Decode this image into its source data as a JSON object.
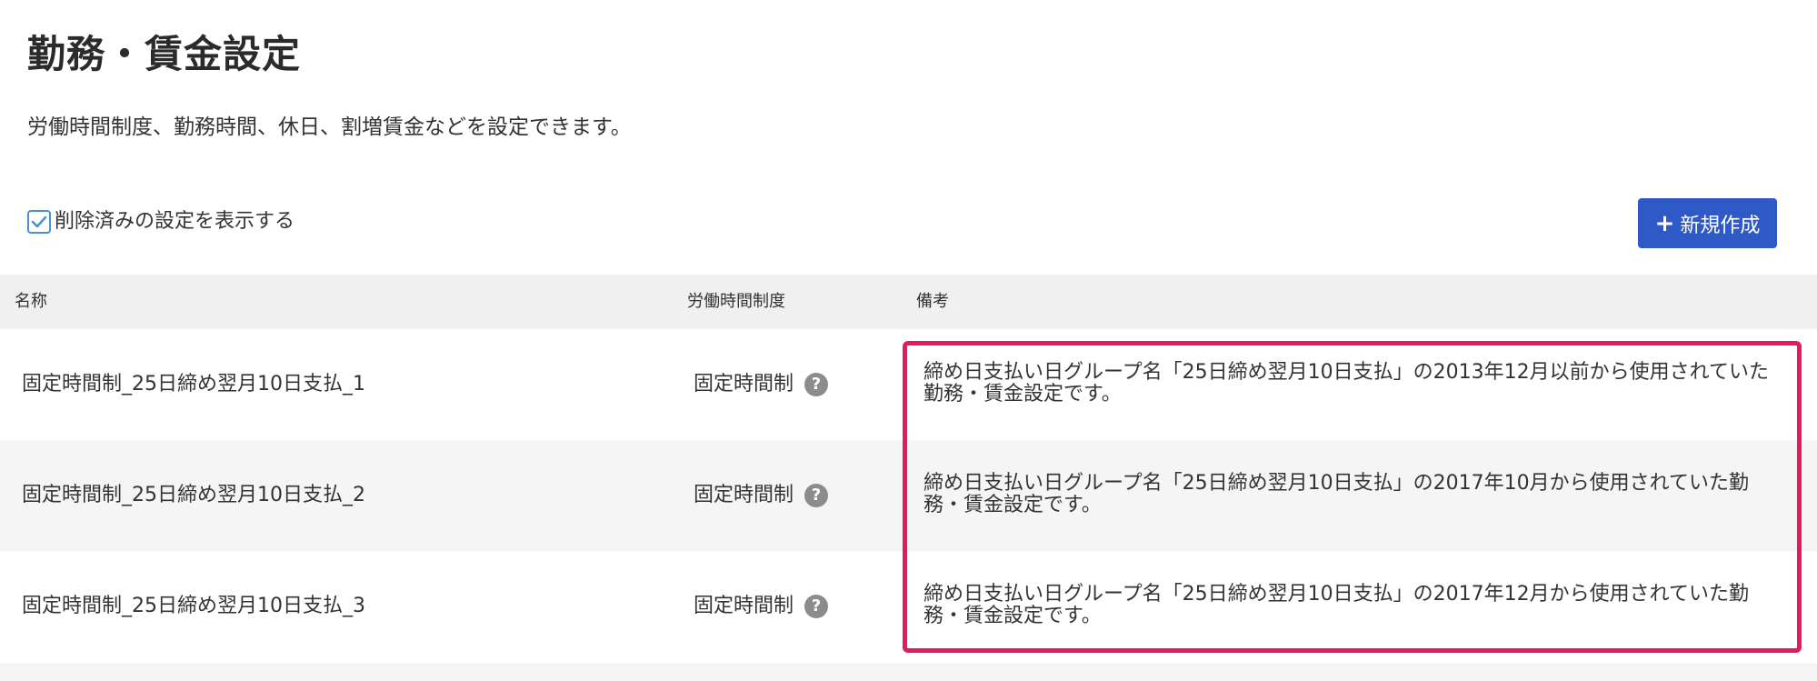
{
  "page": {
    "title": "勤務・賃金設定",
    "description": "労働時間制度、勤務時間、休日、割増賃金などを設定できます。"
  },
  "filters": {
    "show_deleted_label": "削除済みの設定を表示する",
    "show_deleted_checked": true
  },
  "toolbar": {
    "new_button_plus": "+",
    "new_button_label": "新規作成"
  },
  "table": {
    "headers": {
      "name": "名称",
      "system": "労働時間制度",
      "note": "備考"
    },
    "rows": [
      {
        "name": "固定時間制_25日締め翌月10日支払_1",
        "system": "固定時間制",
        "note": "締め日支払い日グループ名「25日締め翌月10日支払」の2013年12月以前から使用されていた勤務・賃金設定です。"
      },
      {
        "name": "固定時間制_25日締め翌月10日支払_2",
        "system": "固定時間制",
        "note": "締め日支払い日グループ名「25日締め翌月10日支払」の2017年10月から使用されていた勤務・賃金設定です。"
      },
      {
        "name": "固定時間制_25日締め翌月10日支払_3",
        "system": "固定時間制",
        "note": "締め日支払い日グループ名「25日締め翌月10日支払」の2017年12月から使用されていた勤務・賃金設定です。"
      }
    ],
    "help_glyph": "?"
  },
  "colors": {
    "primary_button": "#2e59c6",
    "highlight_border": "#e5195f",
    "checkbox_accent": "#4a90d9",
    "help_icon": "#8c8c8c"
  }
}
